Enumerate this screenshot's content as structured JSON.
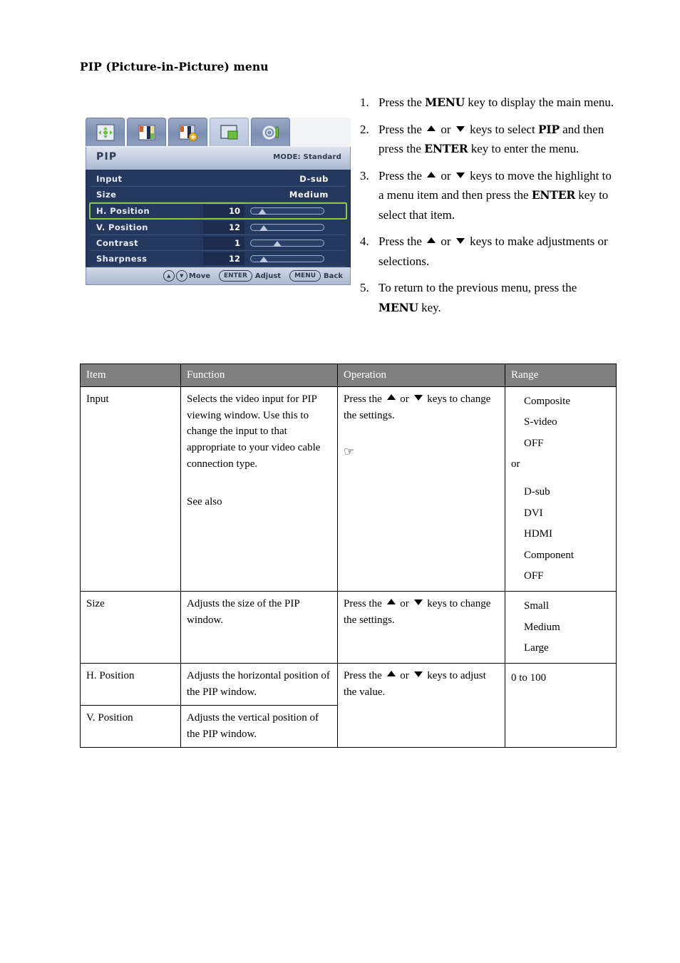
{
  "page": {
    "heading": "PIP (Picture-in-Picture) menu"
  },
  "osd": {
    "tabs": [
      {
        "name": "display-icon",
        "label": "Display"
      },
      {
        "name": "picture-icon",
        "label": "Picture"
      },
      {
        "name": "picture-advanced-icon",
        "label": "Picture Advanced"
      },
      {
        "name": "pip-icon",
        "label": "PIP"
      },
      {
        "name": "system-icon",
        "label": "System"
      }
    ],
    "active_tab_index": 3,
    "title": "PIP",
    "mode": "MODE: Standard",
    "rows": [
      {
        "label": "Input",
        "value": "D-sub",
        "type": "text"
      },
      {
        "label": "Size",
        "value": "Medium",
        "type": "text"
      },
      {
        "label": "H. Position",
        "value": "10",
        "type": "slider",
        "percent": 10,
        "highlight": true
      },
      {
        "label": "V. Position",
        "value": "12",
        "type": "slider",
        "percent": 12,
        "highlight": false
      },
      {
        "label": "Contrast",
        "value": "1",
        "type": "slider",
        "percent": 30,
        "highlight": false
      },
      {
        "label": "Sharpness",
        "value": "12",
        "type": "slider",
        "percent": 12,
        "highlight": false
      }
    ],
    "footer": {
      "up_key": "▲",
      "down_key": "▼",
      "move_label": "Move",
      "enter_key": "ENTER",
      "adjust_label": "Adjust",
      "menu_key": "MENU",
      "back_label": "Back"
    },
    "highlight_color": "#8dc63f",
    "body_color": "#24375c"
  },
  "steps": [
    {
      "num": "1.",
      "parts": [
        {
          "t": "Press the ",
          "k": false
        },
        {
          "t": "MENU",
          "k": true
        },
        {
          "t": " key to display the main menu.",
          "k": false
        }
      ]
    },
    {
      "num": "2.",
      "parts": [
        {
          "t": "Press the ",
          "k": false
        },
        {
          "t": "▲",
          "icon": "up"
        },
        {
          "t": " or ",
          "k": false
        },
        {
          "t": "▼",
          "icon": "down"
        },
        {
          "t": " keys to select ",
          "k": false
        },
        {
          "t": "PIP",
          "k": true
        },
        {
          "t": " and then press the ",
          "k": false
        },
        {
          "t": "ENTER",
          "k": true
        },
        {
          "t": " key to enter the menu.",
          "k": false
        }
      ]
    },
    {
      "num": "3.",
      "parts": [
        {
          "t": "Press the ",
          "k": false
        },
        {
          "t": "▲",
          "icon": "up"
        },
        {
          "t": " or ",
          "k": false
        },
        {
          "t": "▼",
          "icon": "down"
        },
        {
          "t": " keys to move the highlight to a menu item and then press the ",
          "k": false
        },
        {
          "t": "ENTER",
          "k": true
        },
        {
          "t": " key to select that item.",
          "k": false
        }
      ]
    },
    {
      "num": "4.",
      "parts": [
        {
          "t": "Press the ",
          "k": false
        },
        {
          "t": "▲",
          "icon": "up"
        },
        {
          "t": " or ",
          "k": false
        },
        {
          "t": "▼",
          "icon": "down"
        },
        {
          "t": " keys to make adjustments or selections.",
          "k": false
        }
      ]
    },
    {
      "num": "5.",
      "parts": [
        {
          "t": "To return to the previous menu, press the ",
          "k": false
        },
        {
          "t": "MENU",
          "k": true
        },
        {
          "t": " key.",
          "k": false
        }
      ]
    }
  ],
  "table": {
    "headers": [
      "Item",
      "Function",
      "Operation",
      "Range"
    ],
    "rows": [
      {
        "item": "Input",
        "function": "Selects the video input for PIP viewing window. Use this to change the input to that appropriate to your video cable connection type.",
        "function_extra": "See also",
        "operation_pre": "Press the ",
        "operation_mid": " or ",
        "operation_post": " keys to change the settings.",
        "operation_icon": "☞",
        "range": [
          "Composite",
          "S-video",
          "OFF",
          "or",
          "",
          "D-sub",
          "DVI",
          "HDMI",
          "Component",
          "OFF"
        ]
      },
      {
        "item": "Size",
        "function": "Adjusts the size of the PIP window.",
        "operation_pre": "Press the ",
        "operation_mid": " or ",
        "operation_post": " keys to change the settings.",
        "range": [
          "Small",
          "Medium",
          "Large"
        ]
      },
      {
        "item": "H. Position",
        "function": "Adjusts the horizontal position of the PIP window.",
        "operation_pre": "Press the ",
        "operation_mid": " or ",
        "operation_post": " keys to adjust the value.",
        "range": [
          "0 to 100"
        ]
      },
      {
        "item": "V. Position",
        "function": "Adjusts the vertical position of the PIP window."
      }
    ]
  }
}
